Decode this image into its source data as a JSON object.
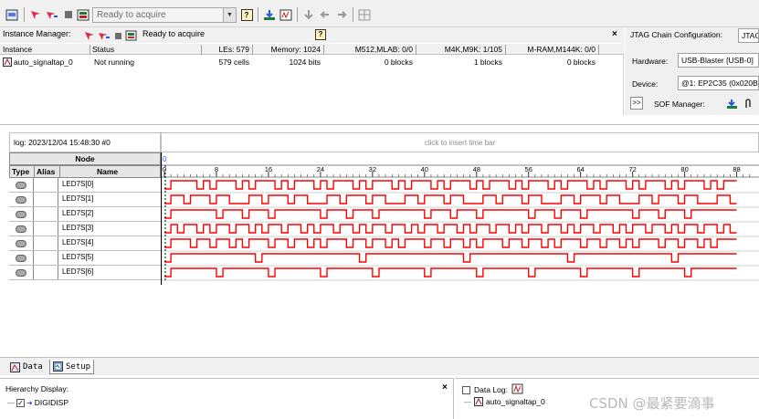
{
  "toolbar": {
    "status_combo": "Ready to acquire",
    "help_label": "?"
  },
  "instance_manager": {
    "title": "Instance Manager:",
    "status": "Ready to acquire",
    "help_label": "?",
    "close_label": "×",
    "columns": [
      "Instance",
      "Status",
      "LEs: 579",
      "Memory: 1024",
      "M512,MLAB: 0/0",
      "M4K,M9K: 1/105",
      "M-RAM,M144K: 0/0"
    ],
    "rows": [
      {
        "instance": "auto_signaltap_0",
        "status": "Not running",
        "les": "579 cells",
        "memory": "1024 bits",
        "m512": "0 blocks",
        "m4k": "1 blocks",
        "mram": "0 blocks"
      }
    ]
  },
  "jtag": {
    "title": "JTAG Chain Configuration:",
    "title_box": "JTAG",
    "hardware_label": "Hardware:",
    "hardware_value": "USB-Blaster [USB-0]",
    "device_label": "Device:",
    "device_value": "@1: EP2C35 (0x020B",
    "more_label": ">>",
    "sof_label": "SOF Manager:"
  },
  "waveform": {
    "log": "log: 2023/12/04 15:48:30  #0",
    "insert_hint": "click to insert time bar",
    "node_header": "Node",
    "columns": {
      "type": "Type",
      "alias": "Alias",
      "name": "Name"
    },
    "cursor_label": "0",
    "ticks": [
      "0",
      "8",
      "16",
      "24",
      "32",
      "40",
      "48",
      "56",
      "64",
      "72",
      "80",
      "88"
    ],
    "signals": [
      {
        "name": "LED7S[0]",
        "pattern": "0111101011101011101011101011101011101011101011101011101011101011101011101011101011101011"
      },
      {
        "name": "LED7S[1]",
        "pattern": "0110111011000110111011000110111011000110111011000110111011000110111011000110111011000110"
      },
      {
        "name": "LED7S[2]",
        "pattern": "0111111101110111011111110111011101111111011101110111111101110111011111110111011101111111"
      },
      {
        "name": "LED7S[3]",
        "pattern": "0101101011011010110110101101101011011010110110101101101011011010110110101101101011011010"
      },
      {
        "name": "LED7S[4]",
        "pattern": "0111011011010111011011010111011011010111011011010111011011010111011011010111011011010111"
      },
      {
        "name": "LED7S[5]",
        "pattern": "0111111111111101111111111111110111111111111111011111111111111101111111111111110111111111"
      },
      {
        "name": "LED7S[6]",
        "pattern": "0111111101111111011111110111111101111111011111110111111101111111011111110111111101111111"
      }
    ],
    "wave_color": "#ff0000"
  },
  "tabs": [
    {
      "label": "Data",
      "icon": "data-icon"
    },
    {
      "label": "Setup",
      "icon": "setup-icon"
    }
  ],
  "hierarchy": {
    "title": "Hierarchy Display:",
    "close_label": "×",
    "item": "DIGIDISP"
  },
  "datalog": {
    "title": "Data Log:",
    "item": "auto_signaltap_0"
  },
  "watermark": "CSDN @最紧要滴事"
}
